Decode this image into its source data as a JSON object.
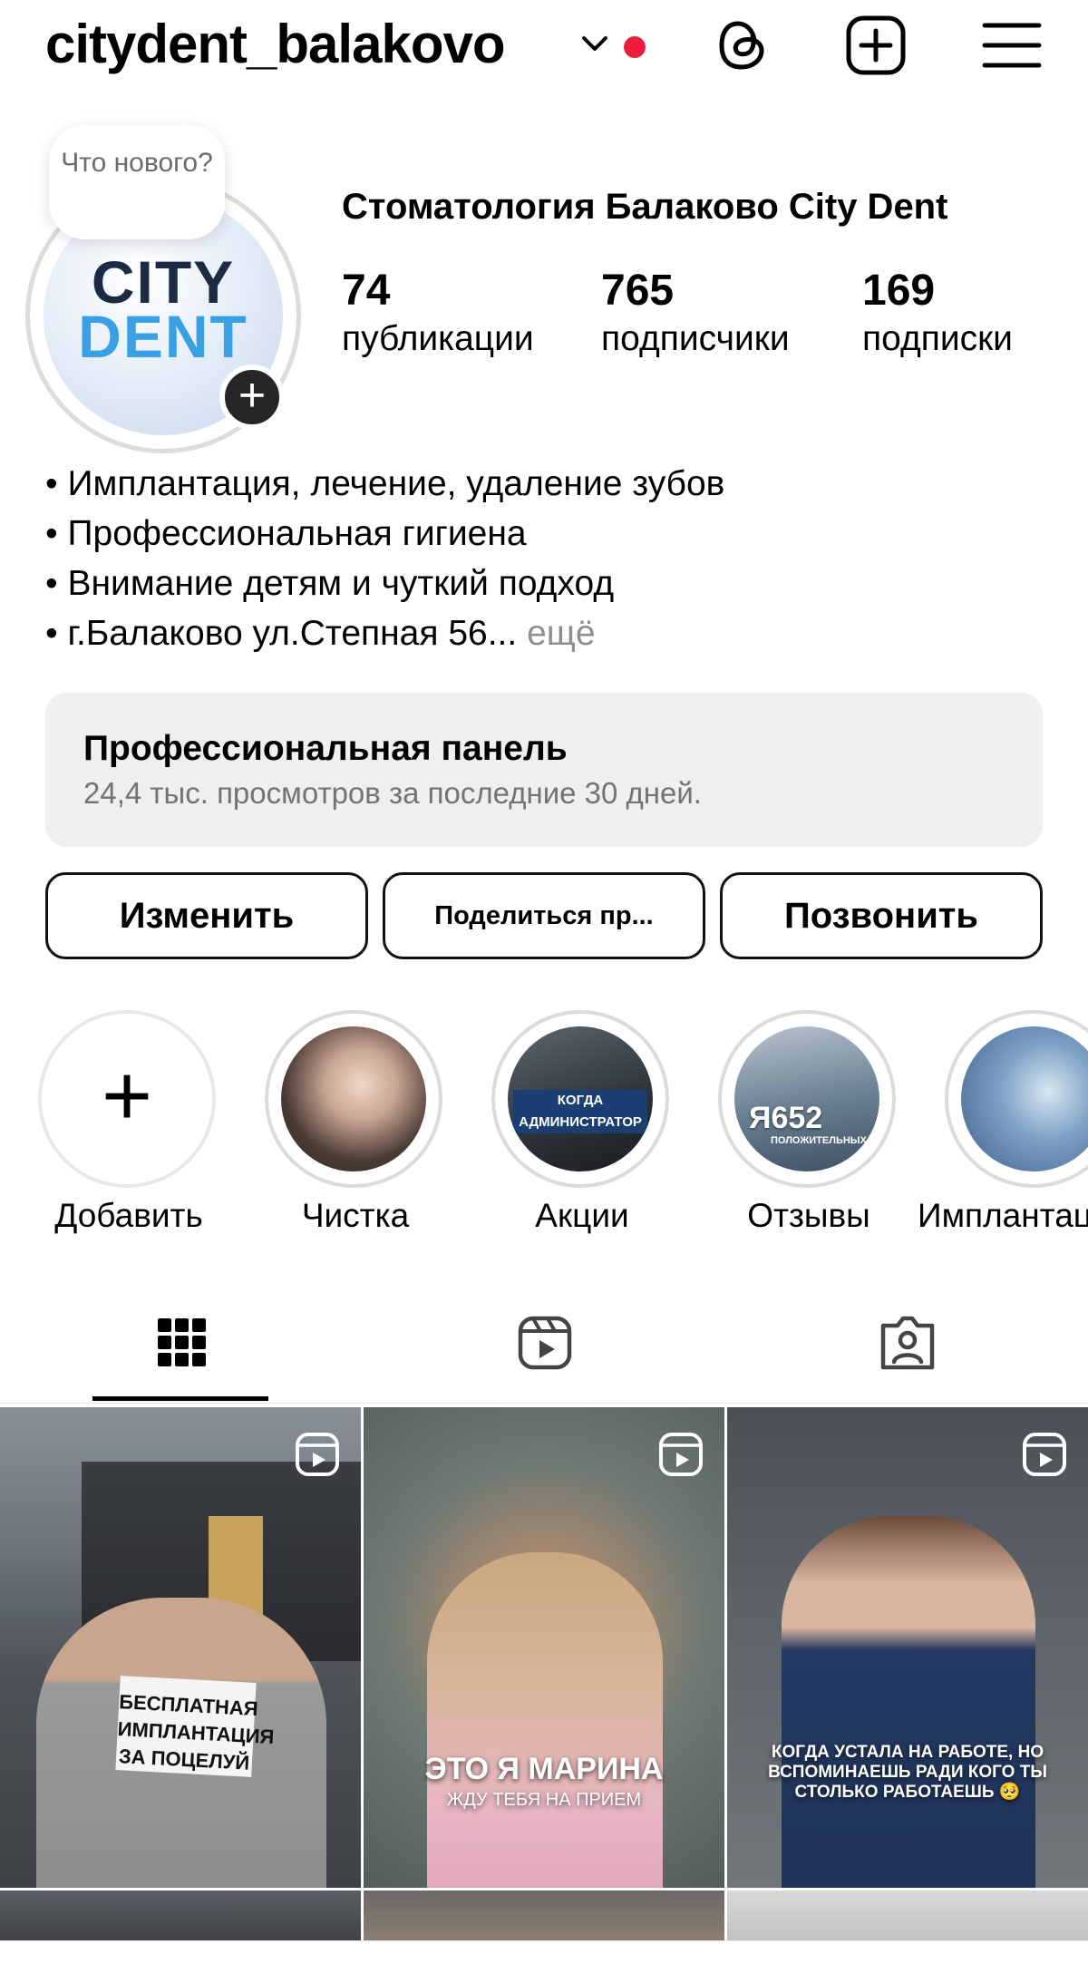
{
  "header": {
    "username": "citydent_balakovo",
    "notification_dot_color": "#ed1c3a",
    "icons": [
      "chevron-down-icon",
      "threads-icon",
      "create-post-icon",
      "menu-icon"
    ]
  },
  "profile": {
    "note_text": "Что нового?",
    "avatar_logo_line1": "CITY",
    "avatar_logo_line2": "DENT",
    "display_name": "Стоматология Балаково City Dent",
    "stats": [
      {
        "value": "74",
        "label": "публикации"
      },
      {
        "value": "765",
        "label": "подписчики"
      },
      {
        "value": "169",
        "label": "подписки"
      }
    ],
    "bio_lines": [
      "• Имплантация, лечение, удаление зубов",
      "• Профессиональная гигиена",
      "• Внимание детям и чуткий подход",
      "• г.Балаково ул.Степная 56..."
    ],
    "bio_more": "ещё"
  },
  "dashboard": {
    "title": "Профессиональная панель",
    "subtitle": "24,4 тыс. просмотров за последние 30 дней."
  },
  "buttons": {
    "edit": "Изменить",
    "share": "Поделиться пр...",
    "call": "Позвонить"
  },
  "highlights": [
    {
      "label": "Добавить"
    },
    {
      "label": "Чистка"
    },
    {
      "label": "Акции",
      "image_text": "КОГДА АДМИНИСТРАТОР"
    },
    {
      "label": "Отзывы",
      "image_text": "Я652",
      "image_subtext": "ПОЛОЖИТЕЛЬНЫХ"
    },
    {
      "label": "Имплантация"
    }
  ],
  "tabs": [
    "grid-icon",
    "reels-icon",
    "tagged-icon"
  ],
  "posts": [
    {
      "caption": "БЕСПЛАТНАЯ ИМПЛАНТАЦИЯ ЗА ПОЦЕЛУЙ"
    },
    {
      "caption": "ЭТО Я МАРИНА",
      "subcaption": "ЖДУ ТЕБЯ НА ПРИЕМ"
    },
    {
      "caption": "КОГДА УСТАЛА НА РАБОТЕ, НО ВСПОМИНАЕШЬ РАДИ КОГО ТЫ СТОЛЬКО РАБОТАЕШЬ 🥺"
    }
  ]
}
